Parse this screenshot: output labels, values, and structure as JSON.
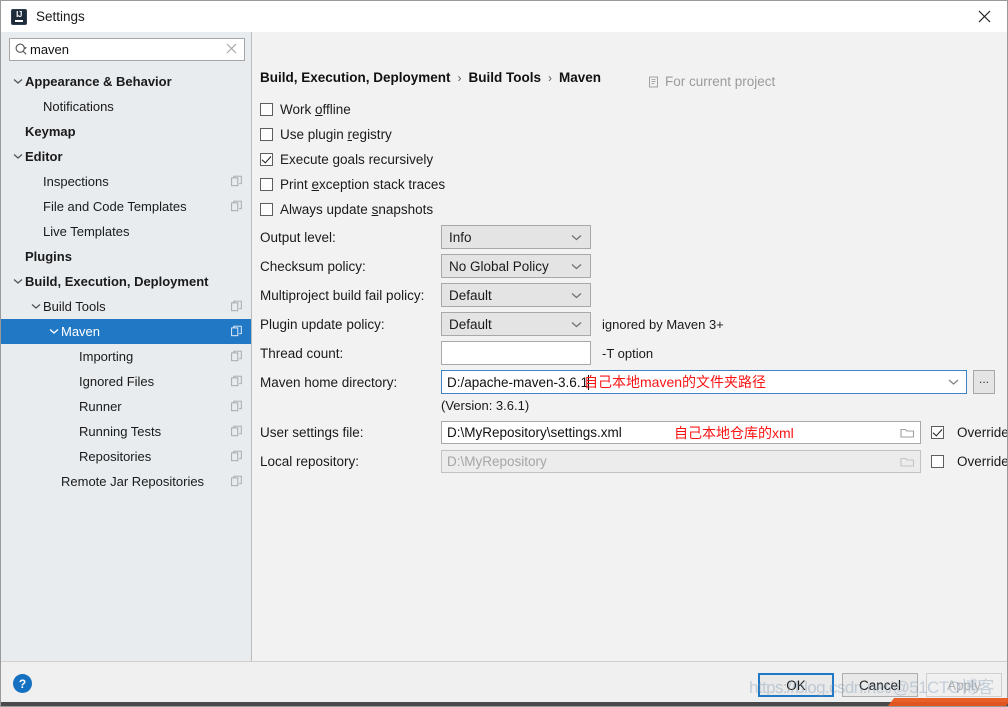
{
  "window": {
    "title": "Settings",
    "app_icon": "intellij-idea-icon",
    "close_icon": "close-icon"
  },
  "search": {
    "value": "maven",
    "placeholder": "Search settings",
    "icon": "search-icon",
    "clear_icon": "clear-icon"
  },
  "sidebar": {
    "items": [
      {
        "label": "Appearance & Behavior",
        "indent": 0,
        "bold": true,
        "arrow": "expanded",
        "copy": false,
        "selected": false
      },
      {
        "label": "Notifications",
        "indent": 1,
        "bold": false,
        "arrow": "none",
        "copy": false,
        "selected": false
      },
      {
        "label": "Keymap",
        "indent": 0,
        "bold": true,
        "arrow": "none",
        "copy": false,
        "selected": false
      },
      {
        "label": "Editor",
        "indent": 0,
        "bold": true,
        "arrow": "expanded",
        "copy": false,
        "selected": false
      },
      {
        "label": "Inspections",
        "indent": 1,
        "bold": false,
        "arrow": "none",
        "copy": true,
        "selected": false
      },
      {
        "label": "File and Code Templates",
        "indent": 1,
        "bold": false,
        "arrow": "none",
        "copy": true,
        "selected": false
      },
      {
        "label": "Live Templates",
        "indent": 1,
        "bold": false,
        "arrow": "none",
        "copy": false,
        "selected": false
      },
      {
        "label": "Plugins",
        "indent": 0,
        "bold": true,
        "arrow": "none",
        "copy": false,
        "selected": false
      },
      {
        "label": "Build, Execution, Deployment",
        "indent": 0,
        "bold": true,
        "arrow": "expanded",
        "copy": false,
        "selected": false
      },
      {
        "label": "Build Tools",
        "indent": 1,
        "bold": false,
        "arrow": "expanded",
        "copy": true,
        "selected": false
      },
      {
        "label": "Maven",
        "indent": 2,
        "bold": false,
        "arrow": "expanded",
        "copy": true,
        "selected": true
      },
      {
        "label": "Importing",
        "indent": 3,
        "bold": false,
        "arrow": "none",
        "copy": true,
        "selected": false
      },
      {
        "label": "Ignored Files",
        "indent": 3,
        "bold": false,
        "arrow": "none",
        "copy": true,
        "selected": false
      },
      {
        "label": "Runner",
        "indent": 3,
        "bold": false,
        "arrow": "none",
        "copy": true,
        "selected": false
      },
      {
        "label": "Running Tests",
        "indent": 3,
        "bold": false,
        "arrow": "none",
        "copy": true,
        "selected": false
      },
      {
        "label": "Repositories",
        "indent": 3,
        "bold": false,
        "arrow": "none",
        "copy": true,
        "selected": false
      },
      {
        "label": "Remote Jar Repositories",
        "indent": 2,
        "bold": false,
        "arrow": "none",
        "copy": true,
        "selected": false
      }
    ]
  },
  "breadcrumb": {
    "part1": "Build, Execution, Deployment",
    "sep1": "›",
    "part2": "Build Tools",
    "sep2": "›",
    "part3": "Maven",
    "scope_label": "For current project",
    "scope_icon": "project-scope-icon"
  },
  "checkboxes": [
    {
      "pre": "Work ",
      "mnemonic": "o",
      "post": "ffline",
      "checked": false
    },
    {
      "pre": "Use plugin ",
      "mnemonic": "r",
      "post": "egistry",
      "checked": false
    },
    {
      "pre": "Execute ",
      "mnemonic": "g",
      "post": "oals recursively",
      "checked": true
    },
    {
      "pre": "Print ",
      "mnemonic": "e",
      "post": "xception stack traces",
      "checked": false
    },
    {
      "pre": "Always update ",
      "mnemonic": "s",
      "post": "napshots",
      "checked": false
    }
  ],
  "form": {
    "output_level": {
      "label": "Output level:",
      "value": "Info"
    },
    "checksum_policy": {
      "label": "Checksum policy:",
      "value": "No Global Policy"
    },
    "multiproject_fail": {
      "label": "Multiproject build fail policy:",
      "value": "Default"
    },
    "plugin_update": {
      "label": "Plugin update policy:",
      "value": "Default",
      "hint": "ignored by Maven 3+"
    },
    "thread_count": {
      "label": "Thread count:",
      "value": "",
      "hint": "-T option"
    },
    "maven_home": {
      "label": "Maven home directory:",
      "value": "D:/apache-maven-3.6.1",
      "annotation": "自己本地maven的文件夹路径",
      "browse_label": "...",
      "version_note": "(Version: 3.6.1)"
    },
    "user_settings": {
      "label": "User settings file:",
      "value": "D:\\MyRepository\\settings.xml",
      "annotation": "自己本地仓库的xml",
      "override_label": "Override",
      "override_checked": true,
      "folder_icon": "folder-icon"
    },
    "local_repository": {
      "label": "Local repository:",
      "value": "D:\\MyRepository",
      "override_label": "Override",
      "override_checked": false,
      "disabled": true,
      "folder_icon": "folder-icon"
    }
  },
  "footer": {
    "help_label": "?",
    "ok_label": "OK",
    "cancel_label": "Cancel",
    "apply_label": "Apply"
  },
  "watermark": {
    "text": "https://blog.csdn.net/@51CTO博客"
  },
  "colors": {
    "selection_blue": "#2178c4",
    "annotation_red": "#fb1414",
    "sidebar_bg": "#e8ecef",
    "main_bg": "#f2f2f2",
    "focus_border": "#3d83c7"
  }
}
